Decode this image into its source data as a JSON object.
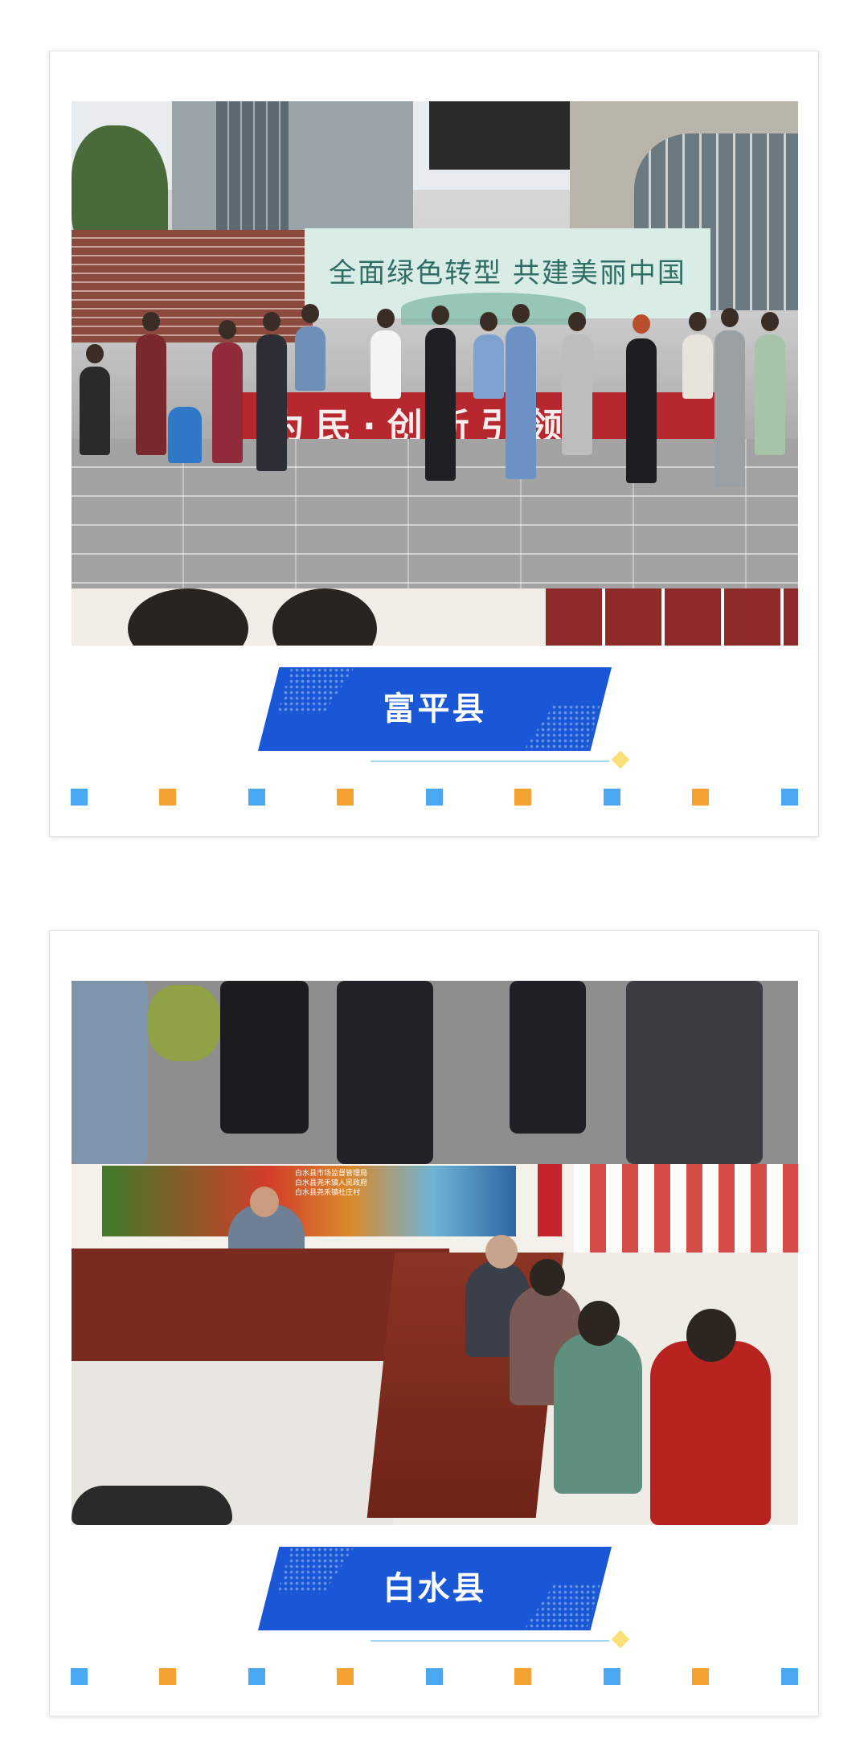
{
  "sections": [
    {
      "caption": "富平县",
      "photo_backdrop_text": "全面绿色转型  共建美丽中国",
      "photo_banner_text": "为民·创新引领"
    },
    {
      "caption": "白水县"
    }
  ],
  "photo_led_text": [
    "白水县市场监督管理局",
    "白水县尧禾镇人民政府",
    "白水县尧禾镇杜庄村"
  ],
  "colors": {
    "caption_bg": "#1a57d6",
    "dot_blue": "#4aa8f0",
    "dot_orange": "#f5a233",
    "diamond": "#fbe07a",
    "underline": "#9fd6f0"
  }
}
